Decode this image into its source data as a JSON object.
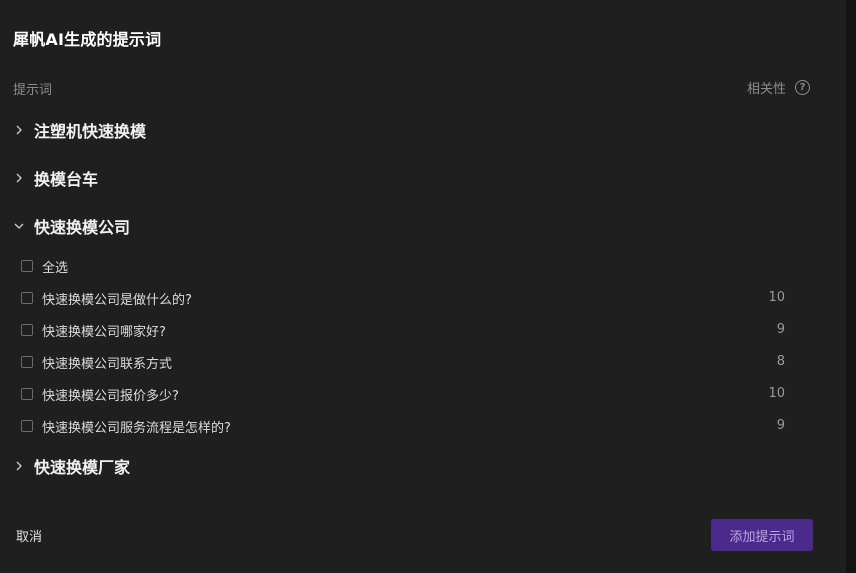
{
  "dialog": {
    "title": "犀帆AI生成的提示词",
    "column_left": "提示词",
    "column_right": "相关性",
    "help_glyph": "?"
  },
  "groups": [
    {
      "label": "注塑机快速换模",
      "expanded": false
    },
    {
      "label": "换模台车",
      "expanded": false
    },
    {
      "label": "快速换模公司",
      "expanded": true
    },
    {
      "label": "快速换模厂家",
      "expanded": false
    }
  ],
  "expanded_group": {
    "select_all_label": "全选",
    "items": [
      {
        "text": "快速换模公司是做什么的?",
        "score": "10"
      },
      {
        "text": "快速换模公司哪家好?",
        "score": "9"
      },
      {
        "text": "快速换模公司联系方式",
        "score": "8"
      },
      {
        "text": "快速换模公司报价多少?",
        "score": "10"
      },
      {
        "text": "快速换模公司服务流程是怎样的?",
        "score": "9"
      }
    ]
  },
  "footer": {
    "cancel_label": "取消",
    "add_label": "添加提示词"
  },
  "colors": {
    "background": "#1f1f1f",
    "primary_button": "#4b2a8c",
    "primary_button_text": "#b9a6e6"
  }
}
